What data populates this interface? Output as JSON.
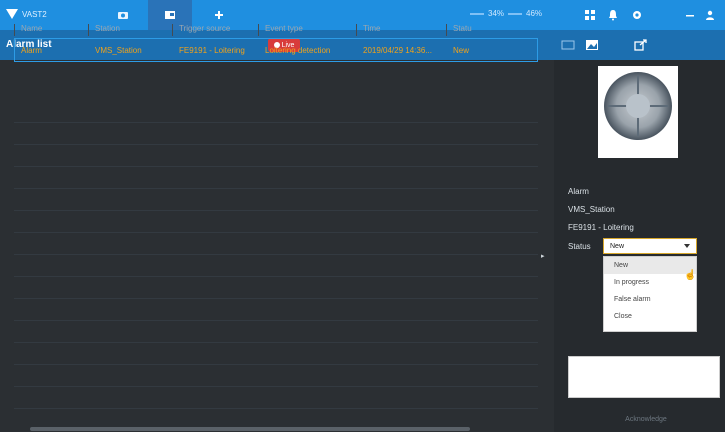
{
  "app": {
    "brand": "VAST2"
  },
  "topbar": {
    "cpu_label": "34%",
    "mem_label": "46%"
  },
  "subbar": {
    "title": "Alarm list",
    "live_label": "Live"
  },
  "table": {
    "columns": [
      "Name",
      "Station",
      "Trigger source",
      "Event type",
      "Time",
      "Statu"
    ],
    "rows": [
      [
        "Alarm",
        "VMS_Station",
        "FE9191 - Loitering",
        "Loitering detection",
        "2019/04/29 14:36...",
        "New"
      ]
    ]
  },
  "detail": {
    "name": "Alarm",
    "station": "VMS_Station",
    "source": "FE9191 - Loitering",
    "status_label": "Status",
    "status_value": "New",
    "status_options": [
      "New",
      "In progress",
      "False alarm",
      "Close"
    ],
    "acknowledge_label": "Acknowledge"
  },
  "colors": {
    "accent": "#1f8fe0",
    "alarm_text": "#f0a21a",
    "live_red": "#d83b3b"
  }
}
